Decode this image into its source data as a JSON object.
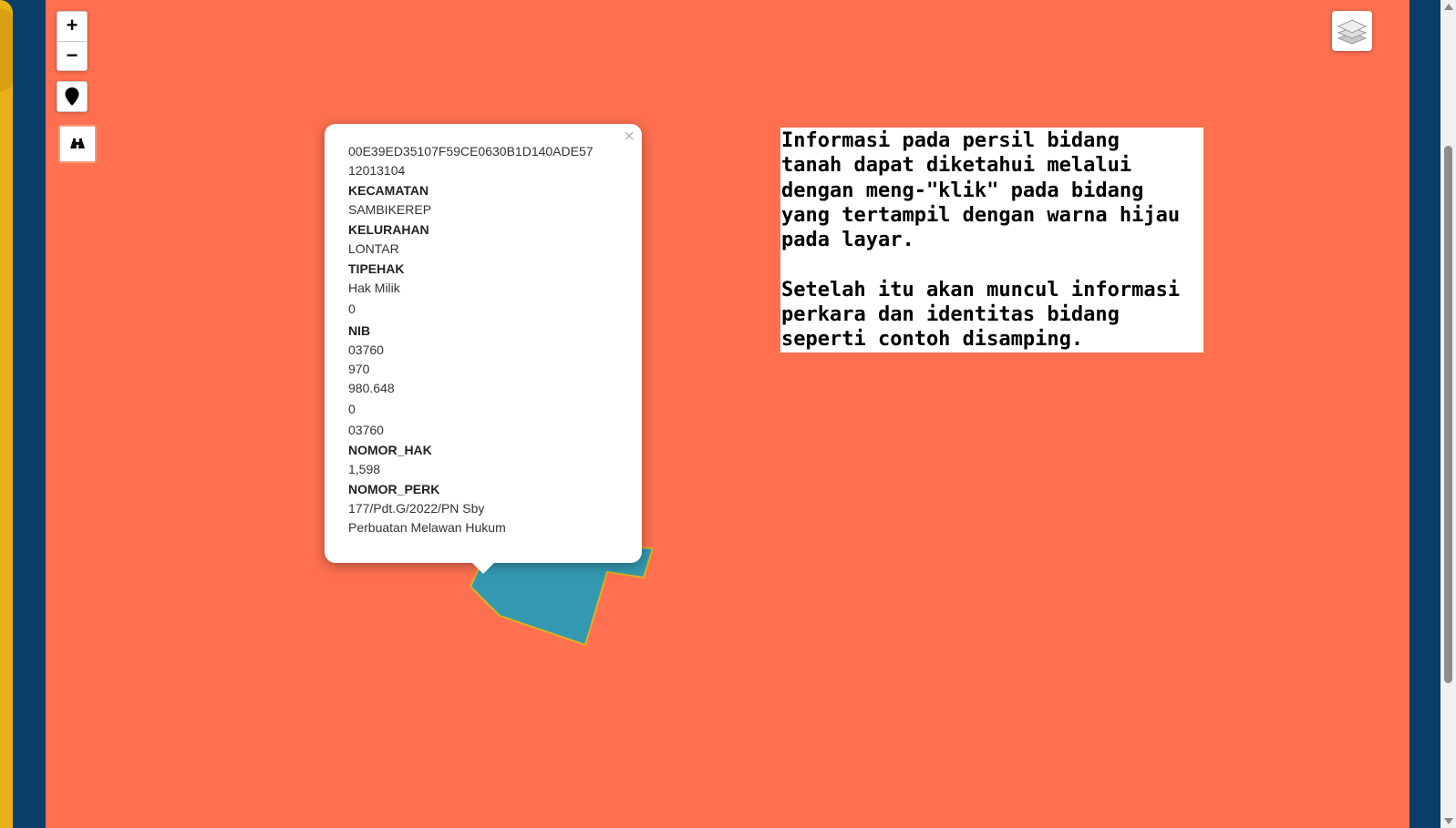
{
  "colors": {
    "map_background": "#fe7050",
    "parcel_fill": "#3399b0",
    "parcel_outline": "#e0b020",
    "frame": "#0b3d6b",
    "side_strip": "#e8b014"
  },
  "map_controls": {
    "zoom_in_label": "+",
    "zoom_out_label": "−",
    "locate_icon": "map-marker-icon",
    "search_icon": "binoculars-icon",
    "layers_icon": "layers-icon"
  },
  "popup": {
    "close_label": "×",
    "id_value": "00E39ED35107F59CE0630B1D140ADE57",
    "code_value": "12013104",
    "kecamatan_label": "KECAMATAN",
    "kecamatan_value": "SAMBIKEREP",
    "kelurahan_label": "KELURAHAN",
    "kelurahan_value": "LONTAR",
    "tipehak_label": "TIPEHAK",
    "tipehak_value": "Hak Milik",
    "value_zero_1": "0",
    "nib_label": "NIB",
    "nib_value": "03760",
    "value_970": "970",
    "value_980": "980.648",
    "value_zero_2": "0",
    "value_03760_b": "03760",
    "nomor_hak_label": "NOMOR_HAK",
    "nomor_hak_value": "1,598",
    "nomor_perk_label": "NOMOR_PERK",
    "nomor_perk_value": "177/Pdt.G/2022/PN Sby",
    "perkara_value": "Perbuatan Melawan Hukum"
  },
  "info_box": {
    "text": "Informasi pada persil bidang\ntanah dapat diketahui melalui\ndengan meng-\"klik\" pada bidang\nyang tertampil dengan warna hijau\npada layar.\n\nSetelah itu akan muncul informasi\nperkara dan identitas bidang\nseperti contoh disamping."
  }
}
